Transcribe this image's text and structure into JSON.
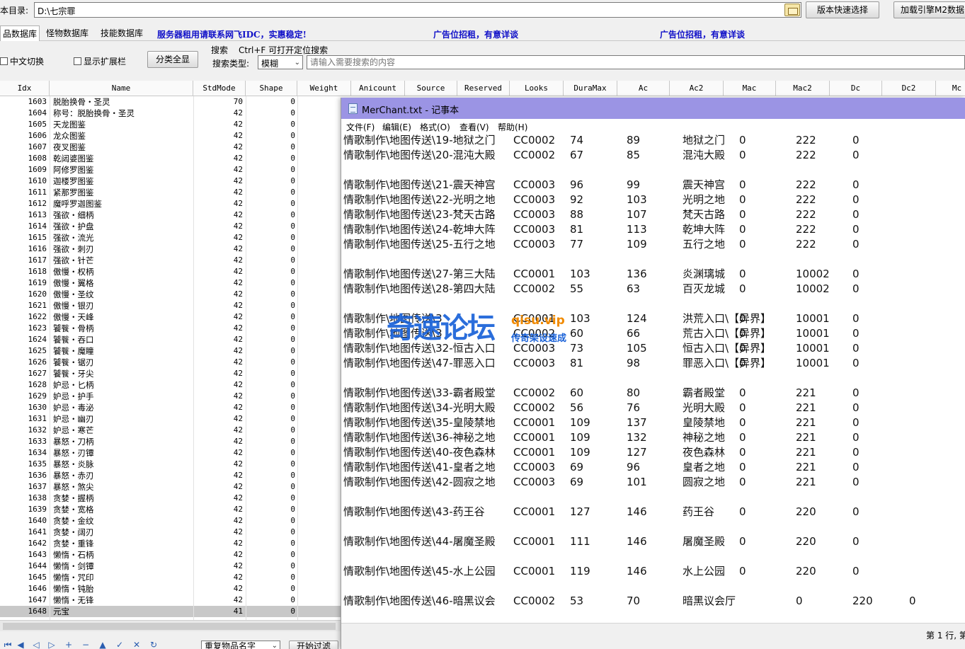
{
  "path": {
    "label": "本目录:",
    "value": "D:\\七宗罪"
  },
  "buttons": {
    "version_select": "版本快速选择",
    "load_engine": "加载引擎M2数据",
    "category_all": "分类全显",
    "start_filter": "开始过滤"
  },
  "tabs": [
    "品数据库",
    "怪物数据库",
    "技能数据库"
  ],
  "ads": [
    "服务器租用请联系网飞IDC，实惠稳定!",
    "广告位招租，有意详谈",
    "广告位招租，有意详谈"
  ],
  "options": {
    "chinese_switch": "中文切换",
    "show_ext_bar": "显示扩展栏"
  },
  "search": {
    "label": "搜索",
    "hint": "Ctrl+F 可打开定位搜索",
    "type_label": "搜索类型:",
    "type_value": "模糊",
    "placeholder": "请输入需要搜索的内容"
  },
  "filter": {
    "select_value": "重复物品名字"
  },
  "grid": {
    "columns": [
      "Idx",
      "Name",
      "StdMode",
      "Shape",
      "Weight",
      "Anicount",
      "Source",
      "Reserved",
      "Looks",
      "DuraMax",
      "Ac",
      "Ac2",
      "Mac",
      "Mac2",
      "Dc",
      "Dc2",
      "Mc"
    ],
    "rows": [
      [
        "1603",
        "脱胎换骨・圣灵",
        "70",
        "0"
      ],
      [
        "1604",
        "称号：脱胎换骨・圣灵",
        "42",
        "0"
      ],
      [
        "1605",
        "天龙图鉴",
        "42",
        "0"
      ],
      [
        "1606",
        "龙众图鉴",
        "42",
        "0"
      ],
      [
        "1607",
        "夜叉图鉴",
        "42",
        "0"
      ],
      [
        "1608",
        "乾闼婆图鉴",
        "42",
        "0"
      ],
      [
        "1609",
        "阿修罗图鉴",
        "42",
        "0"
      ],
      [
        "1610",
        "迦楼罗图鉴",
        "42",
        "0"
      ],
      [
        "1611",
        "紧那罗图鉴",
        "42",
        "0"
      ],
      [
        "1612",
        "魔呼罗迦图鉴",
        "42",
        "0"
      ],
      [
        "1613",
        "强欲・细柄",
        "42",
        "0"
      ],
      [
        "1614",
        "强欲・护盘",
        "42",
        "0"
      ],
      [
        "1615",
        "强欲・流光",
        "42",
        "0"
      ],
      [
        "1616",
        "强欲・刺刃",
        "42",
        "0"
      ],
      [
        "1617",
        "强欲・针芒",
        "42",
        "0"
      ],
      [
        "1618",
        "傲慢・权柄",
        "42",
        "0"
      ],
      [
        "1619",
        "傲慢・翼格",
        "42",
        "0"
      ],
      [
        "1620",
        "傲慢・圣纹",
        "42",
        "0"
      ],
      [
        "1621",
        "傲慢・银刃",
        "42",
        "0"
      ],
      [
        "1622",
        "傲慢・天峰",
        "42",
        "0"
      ],
      [
        "1623",
        "饕餮・骨柄",
        "42",
        "0"
      ],
      [
        "1624",
        "饕餮・吞口",
        "42",
        "0"
      ],
      [
        "1625",
        "饕餮・魔瞳",
        "42",
        "0"
      ],
      [
        "1626",
        "饕餮・锯刃",
        "42",
        "0"
      ],
      [
        "1627",
        "饕餮・牙尖",
        "42",
        "0"
      ],
      [
        "1628",
        "妒忌・匕柄",
        "42",
        "0"
      ],
      [
        "1629",
        "妒忌・护手",
        "42",
        "0"
      ],
      [
        "1630",
        "妒忌・毒泌",
        "42",
        "0"
      ],
      [
        "1631",
        "妒忌・幽刃",
        "42",
        "0"
      ],
      [
        "1632",
        "妒忌・寒芒",
        "42",
        "0"
      ],
      [
        "1633",
        "暴怒・刀柄",
        "42",
        "0"
      ],
      [
        "1634",
        "暴怒・刃镡",
        "42",
        "0"
      ],
      [
        "1635",
        "暴怒・炎脉",
        "42",
        "0"
      ],
      [
        "1636",
        "暴怒・赤刃",
        "42",
        "0"
      ],
      [
        "1637",
        "暴怒・煞尖",
        "42",
        "0"
      ],
      [
        "1638",
        "贪婪・握柄",
        "42",
        "0"
      ],
      [
        "1639",
        "贪婪・宽格",
        "42",
        "0"
      ],
      [
        "1640",
        "贪婪・金纹",
        "42",
        "0"
      ],
      [
        "1641",
        "贪婪・阔刃",
        "42",
        "0"
      ],
      [
        "1642",
        "贪婪・重锋",
        "42",
        "0"
      ],
      [
        "1643",
        "懒惰・石柄",
        "42",
        "0"
      ],
      [
        "1644",
        "懒惰・剑镡",
        "42",
        "0"
      ],
      [
        "1645",
        "懒惰・咒印",
        "42",
        "0"
      ],
      [
        "1646",
        "懒惰・钝胎",
        "42",
        "0"
      ],
      [
        "1647",
        "懒惰・无锋",
        "42",
        "0"
      ],
      [
        "1648",
        "元宝",
        "41",
        "0"
      ]
    ]
  },
  "notepad": {
    "title": "MerChant.txt - 记事本",
    "menu": [
      "文件(F)",
      "编辑(E)",
      "格式(O)",
      "查看(V)",
      "帮助(H)"
    ],
    "lines": [
      [
        "情歌制作\\地图传送\\19-地狱之门",
        "CC0002",
        "74",
        "89",
        "地狱之门",
        "0",
        "222",
        "0",
        ""
      ],
      [
        "情歌制作\\地图传送\\20-混沌大殿",
        "CC0002",
        "67",
        "85",
        "混沌大殿",
        "0",
        "222",
        "0",
        ""
      ],
      [
        "",
        "",
        "",
        "",
        "",
        "",
        "",
        "",
        ""
      ],
      [
        "情歌制作\\地图传送\\21-震天神宫",
        "CC0003",
        "96",
        "99",
        "震天神宫",
        "0",
        "222",
        "0",
        ""
      ],
      [
        "情歌制作\\地图传送\\22-光明之地",
        "CC0003",
        "92",
        "103",
        "光明之地",
        "0",
        "222",
        "0",
        ""
      ],
      [
        "情歌制作\\地图传送\\23-梵天古路",
        "CC0003",
        "88",
        "107",
        "梵天古路",
        "0",
        "222",
        "0",
        ""
      ],
      [
        "情歌制作\\地图传送\\24-乾坤大阵",
        "CC0003",
        "81",
        "113",
        "乾坤大阵",
        "0",
        "222",
        "0",
        ""
      ],
      [
        "情歌制作\\地图传送\\25-五行之地",
        "CC0003",
        "77",
        "109",
        "五行之地",
        "0",
        "222",
        "0",
        ""
      ],
      [
        "",
        "",
        "",
        "",
        "",
        "",
        "",
        "",
        ""
      ],
      [
        "情歌制作\\地图传送\\27-第三大陆",
        "CC0001",
        "103",
        "136",
        "炎渊璃城",
        "0",
        "10002",
        "0",
        ""
      ],
      [
        "情歌制作\\地图传送\\28-第四大陆",
        "CC0002",
        "55",
        "63",
        "百灭龙城",
        "0",
        "10002",
        "0",
        ""
      ],
      [
        "",
        "",
        "",
        "",
        "",
        "",
        "",
        "",
        ""
      ],
      [
        "情歌制作\\地图传送\\3",
        "CC0001",
        "103",
        "124",
        "洪荒入口\\【异界】",
        "0",
        "10001",
        "0",
        ""
      ],
      [
        "情歌制作\\地图传送\\3",
        "CC0002",
        "60",
        "66",
        "荒古入口\\【异界】",
        "0",
        "10001",
        "0",
        ""
      ],
      [
        "情歌制作\\地图传送\\32-恒古入口",
        "CC0003",
        "73",
        "105",
        "恒古入口\\【异界】",
        "0",
        "10001",
        "0",
        ""
      ],
      [
        "情歌制作\\地图传送\\47-罪恶入口",
        "CC0003",
        "81",
        "98",
        "罪恶入口\\【异界】",
        "0",
        "10001",
        "0",
        ""
      ],
      [
        "",
        "",
        "",
        "",
        "",
        "",
        "",
        "",
        ""
      ],
      [
        "情歌制作\\地图传送\\33-霸者殿堂",
        "CC0002",
        "60",
        "80",
        "霸者殿堂",
        "0",
        "221",
        "0",
        ""
      ],
      [
        "情歌制作\\地图传送\\34-光明大殿",
        "CC0002",
        "56",
        "76",
        "光明大殿",
        "0",
        "221",
        "0",
        ""
      ],
      [
        "情歌制作\\地图传送\\35-皇陵禁地",
        "CC0001",
        "109",
        "137",
        "皇陵禁地",
        "0",
        "221",
        "0",
        ""
      ],
      [
        "情歌制作\\地图传送\\36-神秘之地",
        "CC0001",
        "109",
        "132",
        "神秘之地",
        "0",
        "221",
        "0",
        ""
      ],
      [
        "情歌制作\\地图传送\\40-夜色森林",
        "CC0001",
        "109",
        "127",
        "夜色森林",
        "0",
        "221",
        "0",
        ""
      ],
      [
        "情歌制作\\地图传送\\41-皇者之地",
        "CC0003",
        "69",
        "96",
        "皇者之地",
        "0",
        "221",
        "0",
        ""
      ],
      [
        "情歌制作\\地图传送\\42-圆寂之地",
        "CC0003",
        "69",
        "101",
        "圆寂之地",
        "0",
        "221",
        "0",
        ""
      ],
      [
        "",
        "",
        "",
        "",
        "",
        "",
        "",
        "",
        ""
      ],
      [
        "情歌制作\\地图传送\\43-药王谷",
        "CC0001",
        "127",
        "146",
        "药王谷",
        "0",
        "220",
        "0",
        ""
      ],
      [
        "",
        "",
        "",
        "",
        "",
        "",
        "",
        "",
        ""
      ],
      [
        "情歌制作\\地图传送\\44-屠魔圣殿",
        "CC0001",
        "111",
        "146",
        "屠魔圣殿",
        "0",
        "220",
        "0",
        ""
      ],
      [
        "",
        "",
        "",
        "",
        "",
        "",
        "",
        "",
        ""
      ],
      [
        "情歌制作\\地图传送\\45-水上公园",
        "CC0001",
        "119",
        "146",
        "水上公园",
        "0",
        "220",
        "0",
        ""
      ],
      [
        "",
        "",
        "",
        "",
        "",
        "",
        "",
        "",
        ""
      ],
      [
        "情歌制作\\地图传送\\46-暗黑议会",
        "CC0002",
        "53",
        "70",
        "暗黑议会厅",
        "",
        "0",
        "220",
        "0"
      ]
    ],
    "status": "第 1 行, 第"
  },
  "watermark": {
    "main": "奇速论坛",
    "site": "qisu.vip",
    "slogan": "传奇架设速成"
  }
}
